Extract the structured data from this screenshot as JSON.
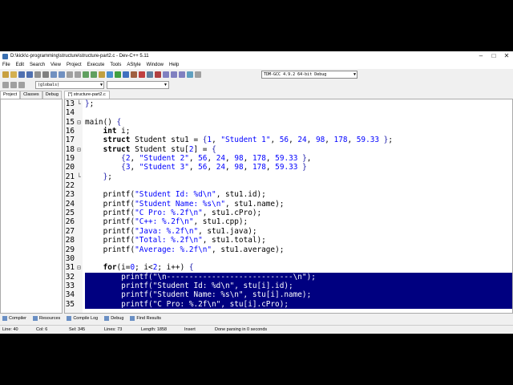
{
  "window": {
    "title": "D:\\kick\\c-programming\\structure\\structure-part2.c - Dev-C++ 5.11"
  },
  "menu": [
    "File",
    "Edit",
    "Search",
    "View",
    "Project",
    "Execute",
    "Tools",
    "AStyle",
    "Window",
    "Help"
  ],
  "toolbar": {
    "compiler": "TDM-GCC 4.9.2 64-bit Debug"
  },
  "scope": {
    "value": "(globals)"
  },
  "left_tabs": [
    "Project",
    "Classes",
    "Debug"
  ],
  "editor_tab": "[*] structure-part2.c",
  "code_lines": [
    {
      "num": "13",
      "fold": "└",
      "text": "};"
    },
    {
      "num": "14",
      "fold": "",
      "text": ""
    },
    {
      "num": "15",
      "fold": "⊟",
      "text": "main() {"
    },
    {
      "num": "16",
      "fold": "",
      "text": "    int i;"
    },
    {
      "num": "17",
      "fold": "",
      "text": "    struct Student stu1 = {1, \"Student 1\", 56, 24, 98, 178, 59.33 };"
    },
    {
      "num": "18",
      "fold": "⊟",
      "text": "    struct Student stu[2] = {"
    },
    {
      "num": "19",
      "fold": "",
      "text": "        {2, \"Student 2\", 56, 24, 98, 178, 59.33 },"
    },
    {
      "num": "20",
      "fold": "",
      "text": "        {3, \"Student 3\", 56, 24, 98, 178, 59.33 }"
    },
    {
      "num": "21",
      "fold": "└",
      "text": "    };"
    },
    {
      "num": "22",
      "fold": "",
      "text": ""
    },
    {
      "num": "23",
      "fold": "",
      "text": "    printf(\"Student Id: %d\\n\", stu1.id);"
    },
    {
      "num": "24",
      "fold": "",
      "text": "    printf(\"Student Name: %s\\n\", stu1.name);"
    },
    {
      "num": "25",
      "fold": "",
      "text": "    printf(\"C Pro: %.2f\\n\", stu1.cPro);"
    },
    {
      "num": "26",
      "fold": "",
      "text": "    printf(\"C++: %.2f\\n\", stu1.cpp);"
    },
    {
      "num": "27",
      "fold": "",
      "text": "    printf(\"Java: %.2f\\n\", stu1.java);"
    },
    {
      "num": "28",
      "fold": "",
      "text": "    printf(\"Total: %.2f\\n\", stu1.total);"
    },
    {
      "num": "29",
      "fold": "",
      "text": "    printf(\"Average: %.2f\\n\", stu1.average);"
    },
    {
      "num": "30",
      "fold": "",
      "text": ""
    },
    {
      "num": "31",
      "fold": "⊟",
      "text": "    for(i=0; i<2; i++) {"
    },
    {
      "num": "32",
      "fold": "",
      "text": "        printf(\"\\n----------------------------\\n\");",
      "selected": true
    },
    {
      "num": "33",
      "fold": "",
      "text": "        printf(\"Student Id: %d\\n\", stu[i].id);",
      "selected": true
    },
    {
      "num": "34",
      "fold": "",
      "text": "        printf(\"Student Name: %s\\n\", stu[i].name);",
      "selected": true
    },
    {
      "num": "35",
      "fold": "",
      "text": "        printf(\"C Pro: %.2f\\n\", stu[i].cPro);",
      "selected": true
    }
  ],
  "bottom_tabs": [
    "Compiler",
    "Resources",
    "Compile Log",
    "Debug",
    "Find Results"
  ],
  "status": {
    "line": "Line:   40",
    "col": "Col:   6",
    "sel": "Sel:   345",
    "lines": "Lines:   73",
    "length": "Length:  1858",
    "mode": "Insert",
    "message": "Done parsing in 0 seconds"
  }
}
